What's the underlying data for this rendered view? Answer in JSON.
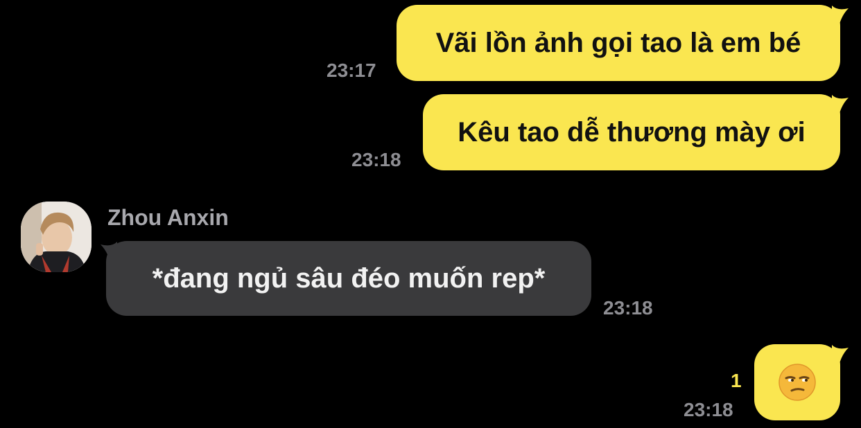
{
  "chat": {
    "messages": [
      {
        "direction": "outgoing",
        "text": "Vãi lồn ảnh gọi tao là em bé",
        "time": "23:17"
      },
      {
        "direction": "outgoing",
        "text": "Kêu tao dễ thương mày ơi",
        "time": "23:18"
      },
      {
        "direction": "incoming",
        "sender": "Zhou Anxin",
        "text": "*đang ngủ sâu đéo muốn rep*",
        "time": "23:18"
      },
      {
        "direction": "outgoing",
        "emoji": "unamused-face",
        "time": "23:18",
        "unread_count": "1"
      }
    ]
  },
  "colors": {
    "background": "#000000",
    "outgoing_bubble": "#fae650",
    "incoming_bubble": "#3a3a3c",
    "timestamp": "#8e8e93",
    "unread": "#fae650"
  },
  "icons": {
    "avatar": "profile-photo",
    "emoji": "unamused-face-icon"
  }
}
